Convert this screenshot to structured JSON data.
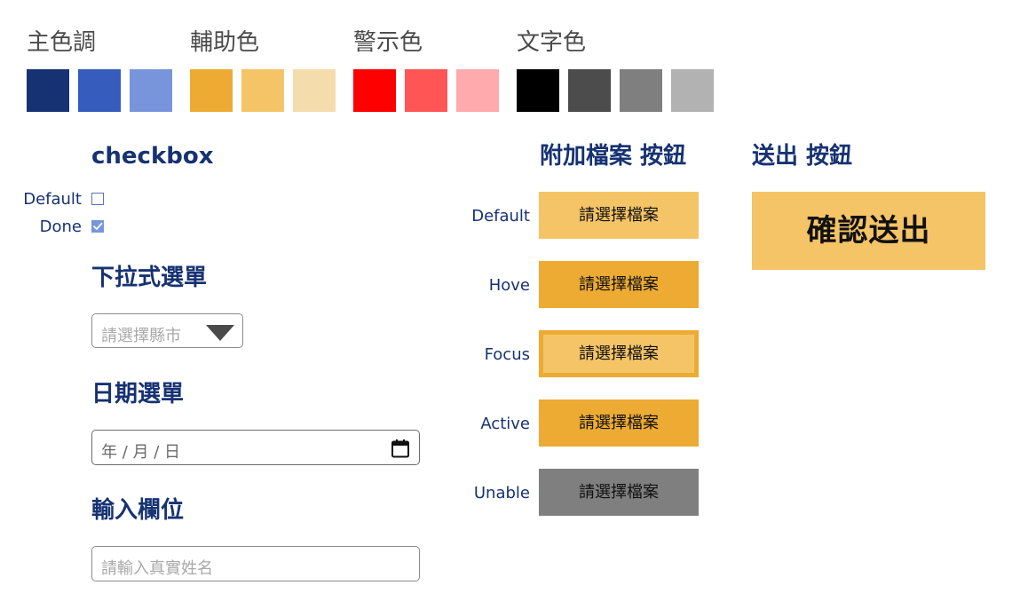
{
  "palette": {
    "groups": [
      {
        "title": "主色調",
        "colors": [
          "#163272",
          "#365dbd",
          "#7895dc"
        ]
      },
      {
        "title": "輔助色",
        "colors": [
          "#edab33",
          "#f5c466",
          "#f5dcad"
        ]
      },
      {
        "title": "警示色",
        "colors": [
          "#ff0000",
          "#ff5555",
          "#ffaaad"
        ]
      },
      {
        "title": "文字色",
        "colors": [
          "#000000",
          "#4c4c4c",
          "#7f7f7f",
          "#b2b2b2"
        ]
      }
    ]
  },
  "checkbox": {
    "title": "checkbox",
    "items": [
      {
        "label": "Default",
        "checked": false
      },
      {
        "label": "Done",
        "checked": true
      }
    ]
  },
  "dropdown": {
    "title": "下拉式選單",
    "placeholder": "請選擇縣市"
  },
  "date_picker": {
    "title": "日期選單",
    "placeholder": "年 / 月 / 日"
  },
  "text_field": {
    "title": "輸入欄位",
    "placeholder": "請輸入真實姓名"
  },
  "attach_buttons": {
    "title": "附加檔案 按鈕",
    "label": "請選擇檔案",
    "states": [
      {
        "state": "Default",
        "bg": "#f5c466",
        "inner": ""
      },
      {
        "state": "Hove",
        "bg": "#edab33",
        "inner": ""
      },
      {
        "state": "Focus",
        "bg": "#f5c466",
        "inner": "#edab33"
      },
      {
        "state": "Active",
        "bg": "#edab33",
        "inner": ""
      },
      {
        "state": "Unable",
        "bg": "#7f7f7f",
        "inner": ""
      }
    ]
  },
  "submit": {
    "title": "送出 按鈕",
    "label": "確認送出",
    "bg": "#f5c466"
  }
}
